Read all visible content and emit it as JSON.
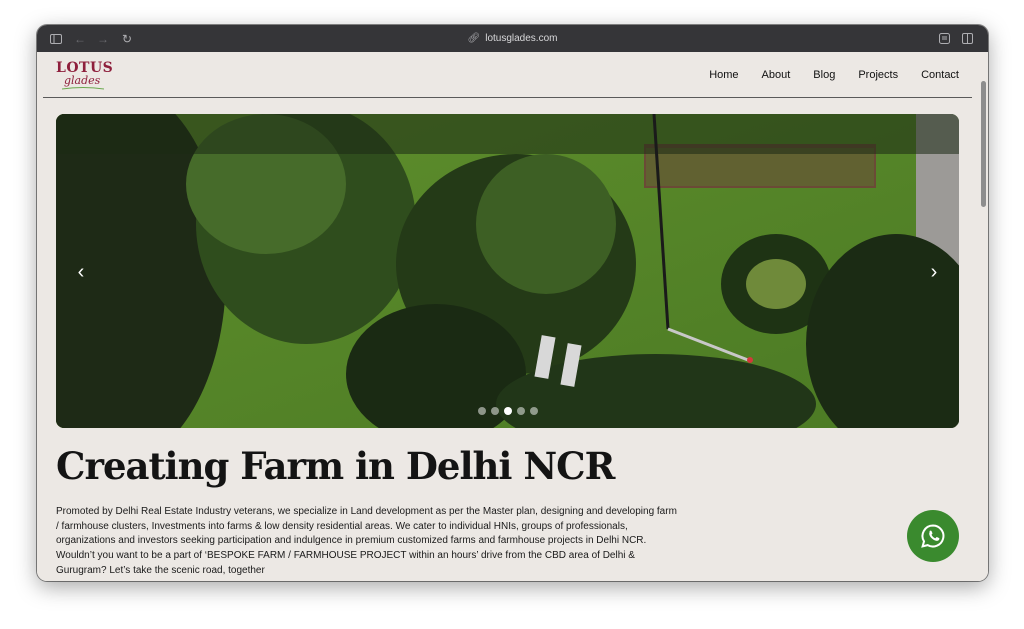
{
  "browser": {
    "url": "lotusglades.com",
    "icons": {
      "sidebar": "sidebar-icon",
      "back": "back-arrow-icon",
      "forward": "forward-arrow-icon",
      "reload": "reload-icon",
      "link": "link-icon",
      "reader": "reader-icon",
      "split": "split-view-icon"
    }
  },
  "header": {
    "logo_top": "LOTUS",
    "logo_bottom": "glades",
    "nav": [
      "Home",
      "About",
      "Blog",
      "Projects",
      "Contact"
    ]
  },
  "slider": {
    "slide_count": 5,
    "active_index": 2,
    "image": "aerial garden lawn with trees"
  },
  "main": {
    "headline": "Creating Farm in Delhi NCR",
    "body": "Promoted by Delhi Real Estate Industry veterans, we specialize in Land development as per the Master plan, designing and developing farm / farmhouse clusters, Investments into farms & low density residential areas. We cater to individual HNIs, groups of professionals, organizations and investors seeking participation and indulgence in premium customized farms and farmhouse projects in Delhi NCR. Wouldn’t you want to be a part of ‘BESPOKE FARM / FARMHOUSE PROJECT within an hours’ drive from the CBD area of Delhi & Gurugram? Let’s take the scenic road, together"
  },
  "colors": {
    "brand": "#8e1f3c",
    "whatsapp": "#3a8a2e",
    "page_bg": "#ece8e4"
  }
}
